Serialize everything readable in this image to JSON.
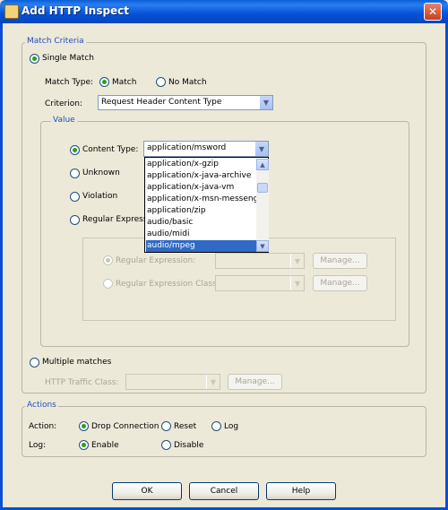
{
  "window": {
    "title": "Add HTTP Inspect",
    "close_glyph": "✕"
  },
  "match_criteria": {
    "legend": "Match Criteria",
    "single_match_label": "Single Match",
    "match_type": {
      "label": "Match Type:",
      "match_label": "Match",
      "no_match_label": "No Match",
      "selected": "Match"
    },
    "criterion": {
      "label": "Criterion:",
      "value": "Request Header Content Type"
    },
    "value_group": {
      "legend": "Value",
      "content_type_label": "Content Type:",
      "content_type_value": "application/msword",
      "unknown_label": "Unknown",
      "violation_label": "Violation",
      "regex_label": "Regular Expression",
      "dropdown_options": [
        "application/x-gzip",
        "application/x-java-archive",
        "application/x-java-vm",
        "application/x-msn-messenger",
        "application/zip",
        "audio/basic",
        "audio/midi",
        "audio/mpeg"
      ],
      "dropdown_highlighted": "audio/mpeg",
      "regex_sub": {
        "regex_label": "Regular Expression:",
        "regex_class_label": "Regular Expression Class:",
        "manage_label": "Manage..."
      }
    },
    "multiple_matches_label": "Multiple matches",
    "http_traffic_class_label": "HTTP Traffic Class:",
    "manage_label": "Manage..."
  },
  "actions": {
    "legend": "Actions",
    "action_label": "Action:",
    "drop_connection_label": "Drop Connection",
    "reset_label": "Reset",
    "log_label": "Log",
    "log_row_label": "Log:",
    "enable_label": "Enable",
    "disable_label": "Disable"
  },
  "buttons": {
    "ok": "OK",
    "cancel": "Cancel",
    "help": "Help"
  },
  "colors": {
    "title_bar": "#0553d6",
    "dialog_bg": "#ece9d8",
    "legend_text": "#1f4fbf",
    "selection": "#316ac5"
  }
}
